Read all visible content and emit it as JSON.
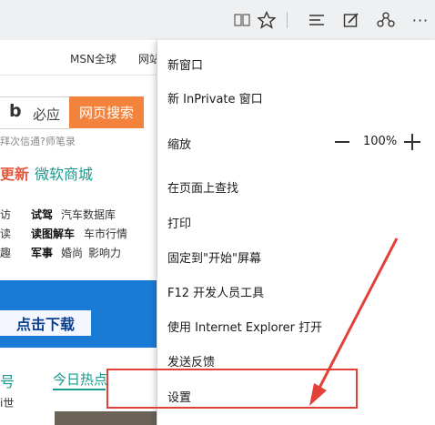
{
  "toolbar": {
    "icons": [
      "reading-view-icon",
      "favorite-star-icon",
      "hub-icon",
      "web-note-icon",
      "share-icon",
      "more-icon"
    ],
    "more_label": "···"
  },
  "page": {
    "nav": {
      "msn": "MSN全球",
      "cut_link": "网站"
    },
    "search": {
      "bing_brand": "必应",
      "button": "网页搜索",
      "hint": "拜次信通?师笔录"
    },
    "tabs": {
      "news_fragment": "更新",
      "mall": "微软商城"
    },
    "grid": [
      [
        "试驾",
        "汽车数据库"
      ],
      [
        "读图解车",
        "车市行情"
      ],
      [
        "军事",
        "婚尚",
        "影响力"
      ]
    ],
    "grid_left_chars": [
      "访",
      "读",
      "趣"
    ],
    "banner_button": "点击下载",
    "hot": {
      "left_fragment": "号",
      "tab": "今日热点",
      "small": "i世"
    }
  },
  "menu": {
    "items": [
      "新窗口",
      "新 InPrivate 窗口",
      "缩放",
      "在页面上查找",
      "打印",
      "固定到\"开始\"屏幕",
      "F12 开发人员工具",
      "使用 Internet Explorer 打开",
      "发送反馈",
      "设置"
    ],
    "zoom_value": "100%"
  },
  "colors": {
    "accent_orange": "#f2823c",
    "accent_teal": "#179a8f",
    "annotation_red": "#e3403a"
  }
}
